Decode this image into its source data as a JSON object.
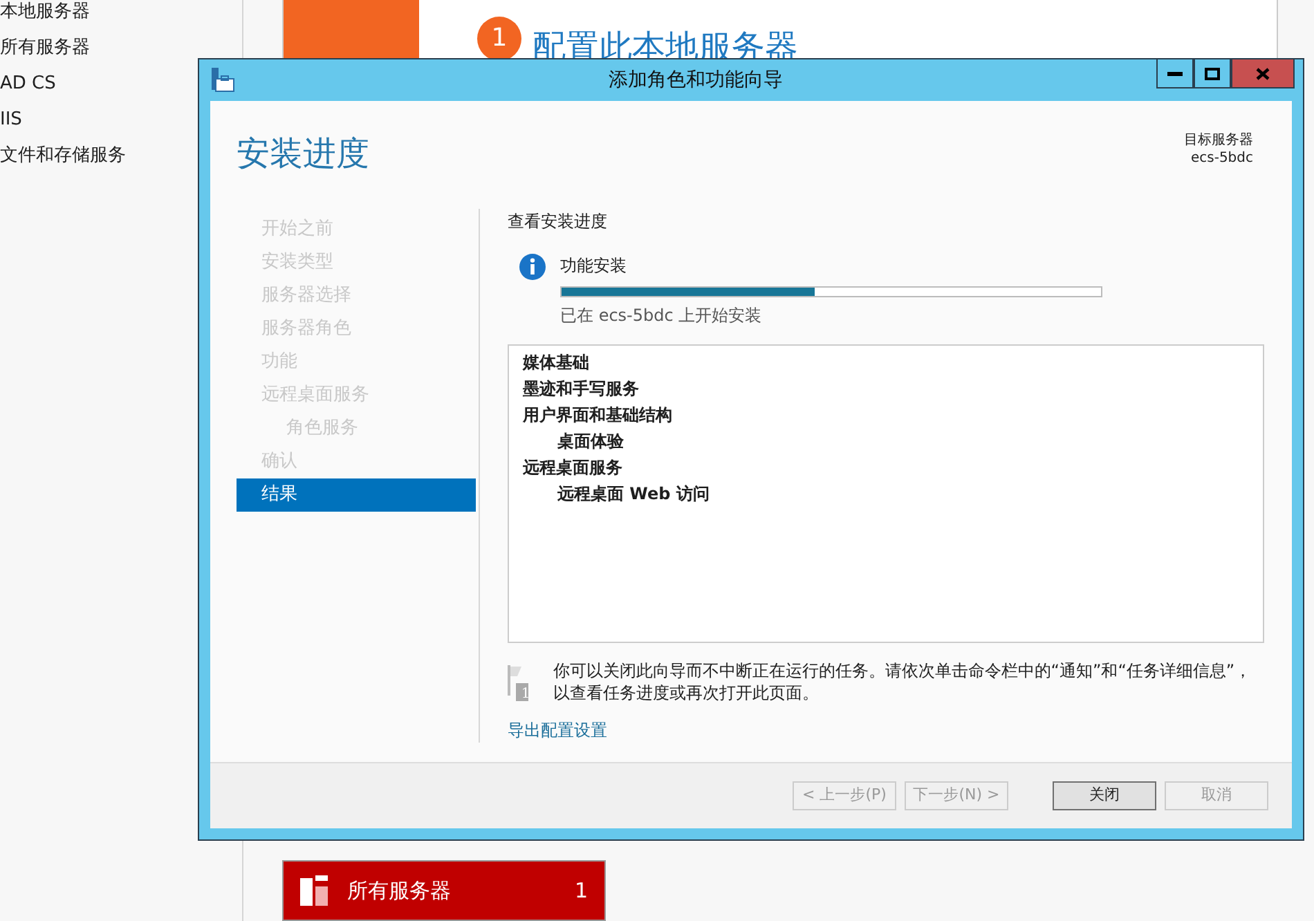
{
  "background": {
    "nav_items": [
      "本地服务器",
      "所有服务器",
      "AD CS",
      "IIS",
      "文件和存储服务"
    ],
    "tile": {
      "step": "1",
      "title": "配置此本地服务器"
    },
    "bottom_tile": {
      "label": "所有服务器",
      "count": "1"
    }
  },
  "dialog": {
    "title": "添加角色和功能向导",
    "heading": "安装进度",
    "target_label": "目标服务器",
    "target_name": "ecs-5bdc",
    "steps": [
      {
        "label": "开始之前",
        "selected": false
      },
      {
        "label": "安装类型",
        "selected": false
      },
      {
        "label": "服务器选择",
        "selected": false
      },
      {
        "label": "服务器角色",
        "selected": false
      },
      {
        "label": "功能",
        "selected": false
      },
      {
        "label": "远程桌面服务",
        "selected": false,
        "children": [
          {
            "label": "角色服务",
            "selected": false
          }
        ]
      },
      {
        "label": "确认",
        "selected": false
      },
      {
        "label": "结果",
        "selected": true
      }
    ],
    "section_title": "查看安装进度",
    "progress": {
      "title": "功能安装",
      "level": 0.47,
      "status": "已在 ecs-5bdc 上开始安装"
    },
    "features": [
      {
        "label": "媒体基础"
      },
      {
        "label": "墨迹和手写服务"
      },
      {
        "label": "用户界面和基础结构",
        "children": [
          {
            "label": "桌面体验"
          }
        ]
      },
      {
        "label": "远程桌面服务",
        "children": [
          {
            "label": "远程桌面 Web 访问"
          }
        ]
      }
    ],
    "note": {
      "flag_number": "1",
      "text": "你可以关闭此向导而不中断正在运行的任务。请依次单击命令栏中的“通知”和“任务详细信息”，以查看任务进度或再次打开此页面。"
    },
    "export_link": "导出配置设置",
    "buttons": [
      {
        "label": "< 上一步(P)",
        "disabled": true,
        "default": false
      },
      {
        "label": "下一步(N) >",
        "disabled": true,
        "default": false
      },
      {
        "label": "关闭",
        "disabled": false,
        "default": true
      },
      {
        "label": "取消",
        "disabled": true,
        "default": false
      }
    ]
  }
}
